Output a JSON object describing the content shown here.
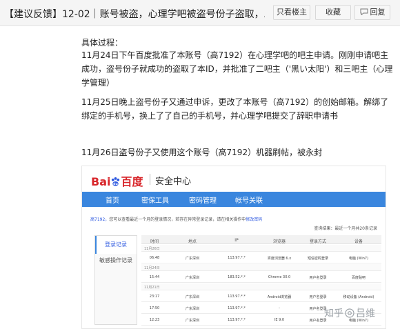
{
  "header": {
    "title": "【建议反馈】12-02｜账号被盗，心理学吧被盗号份子盗取，发...",
    "buttons": {
      "only_op": "只看楼主",
      "favorite": "收藏",
      "reply": "回复"
    }
  },
  "post": {
    "paragraphs": [
      "具体过程：",
      "11月24日下午百度批准了本账号（高7192）在心理学吧的吧主申请。刚刚申请吧主成功，盗号份子就成功的盗取了本ID，并批准了二吧主（'黑い太阳'）和三吧主（心理学管理）",
      "11月25日晚上盗号份子又通过申诉，更改了本账号（高7192）的创始邮箱。解绑了绑定的手机号，换上了了自己的手机号，并心理学吧提交了辞职申请书",
      "11月26日盗号份子又使用这个账号（高7192）机器刷帖，被永封"
    ]
  },
  "screenshot": {
    "logo_text_bai": "Bai",
    "logo_text_du": "du",
    "logo_text_cn": "百度",
    "center_title": "安全中心",
    "nav": [
      "首页",
      "密保工具",
      "密码管理",
      "帐号关联"
    ],
    "notice_prefix": "高7192，",
    "notice_text": "您可以查看最近一个月的登录情况，若存在异常登录记录，请在相关操作中",
    "notice_link": "修改密码",
    "query_text": "查询结果：最近一个月共20条记录",
    "side_tabs": [
      "登录记录",
      "敏感操作记录"
    ],
    "table": {
      "headers": [
        "时间",
        "地点",
        "IP",
        "浏览器",
        "登录方式",
        "设备"
      ],
      "rows": [
        {
          "date": "11月26日"
        },
        {
          "cells": [
            "06:48",
            "广东深圳",
            "113.97.*.*",
            "百度浏览器 6.x",
            "短信密码登录",
            "电脑 (Win7)"
          ]
        },
        {
          "date": "11月24日"
        },
        {
          "cells": [
            "15:44",
            "广东深圳",
            "183.52.*.*",
            "Chrome 30.0",
            "用户名登录",
            "百度贴吧"
          ]
        },
        {
          "date": "11月21日"
        },
        {
          "cells": [
            "23:17",
            "广东深圳",
            "113.97.*.*",
            "Android浏览器",
            "用户名登录",
            "移动设备 (Android)"
          ]
        },
        {
          "cells": [
            "17:50",
            "广东深圳",
            "113.97.*.*",
            "-",
            "用户名登录",
            "-"
          ]
        },
        {
          "cells": [
            "12:23",
            "广东深圳",
            "113.97.*.*",
            "IE 9.0",
            "用户名登录",
            "电脑 (Win7)"
          ]
        }
      ]
    }
  },
  "watermark": {
    "prefix": "知乎",
    "name": "吕维"
  },
  "colors": {
    "accent_blue": "#3a86de",
    "baidu_red": "#d8262b"
  }
}
